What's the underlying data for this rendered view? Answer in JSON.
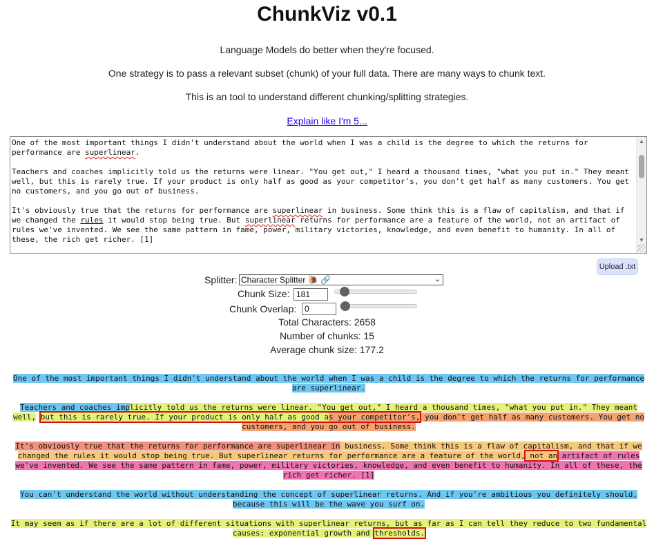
{
  "header": {
    "title": "ChunkViz v0.1",
    "line1": "Language Models do better when they're focused.",
    "line2": "One strategy is to pass a relevant subset (chunk) of your full data. There are many ways to chunk text.",
    "line3": "This is an tool to understand different chunking/splitting strategies.",
    "explain_link": "Explain like I'm 5..."
  },
  "textarea": {
    "p1a": "One of the most important things I didn't understand about the world when I was a child is the degree to which the returns for\nperformance are ",
    "p1w": "superlinear",
    "p1b": ".\n\nTeachers and coaches implicitly told us the returns were linear. \"You get out,\" I heard a thousand times, \"what you put in.\" They meant\nwell, but this is rarely true. If your product is only half as good as your competitor's, you don't get half as many customers. You get\nno customers, and you go out of business.\n\nIt's obviously true that the returns for performance are ",
    "p2w": "superlinear",
    "p2b": " in business. Some think this is a flaw of capitalism, and that if\nwe changed the ",
    "p2r": "rules",
    "p2c": " it would stop being true. But ",
    "p2s": "superlinear",
    "p2d": " returns for performance are a feature of the world, not an artifact of\nrules we've invented. We see the same pattern in fame, power, military victories, knowledge, and even benefit to humanity. In all of\nthese, the rich get richer. [1]"
  },
  "upload_label": "Upload .txt",
  "controls": {
    "splitter_label": "Splitter:",
    "splitter_value": "Character Splitter",
    "chunk_size_label": "Chunk Size:",
    "chunk_size_value": "181",
    "chunk_size_slider_fraction": 0.07,
    "chunk_overlap_label": "Chunk Overlap:",
    "chunk_overlap_value": "0",
    "chunk_overlap_slider_fraction": 0.0
  },
  "stats": {
    "total": "Total Characters: 2658",
    "count": "Number of chunks: 15",
    "avg": "Average chunk size: 177.2"
  },
  "colors": {
    "blue": "#6ec7f2",
    "yellow": "#e4f27a",
    "orange": "#f4a271",
    "pink": "#f174b2",
    "salmon": "#f0907e",
    "overlap_border": "#d41111"
  },
  "chunks": {
    "c1": "One of the most important things I didn't understand about the world when I was a child is the degree to which the returns for performance are superlinear.",
    "c2a": "Teachers and coaches imp",
    "c2b": "licitly told us the returns were linear. \"You get out,\" I heard a thousand times, \"what you put in.\" They meant well,",
    "c2c": "but this is rarely true. If your product is only half as good a",
    "c2d": "s your competitor's,",
    "c2e": " you don't get half as many customers. You get no customers, and you go out of business.",
    "c3a": "It's obviously true that the returns for performance are superlinear in",
    "c3b": " business. Some think this is a flaw of capitalism, and that if we changed the rules it would stop being true. But superlinear returns for performance are a feature of the world,",
    "c3c": " not an",
    "c3d": " artifact of rules we've invented. We see the same pattern in fame, power, military victories, knowledge, and even benefit to humanity. In all of these, the rich get richer. [1]",
    "c4": "You can't understand the world without understanding the concept of superlinear returns. And if you're ambitious you definitely should, because this will be the wave you surf on.",
    "c5a": "It may seem as if there are a lot of different situations with superlinear returns, but as far as I can tell they reduce to two fundamental causes: exponential growth and ",
    "c5b": "thresholds."
  }
}
